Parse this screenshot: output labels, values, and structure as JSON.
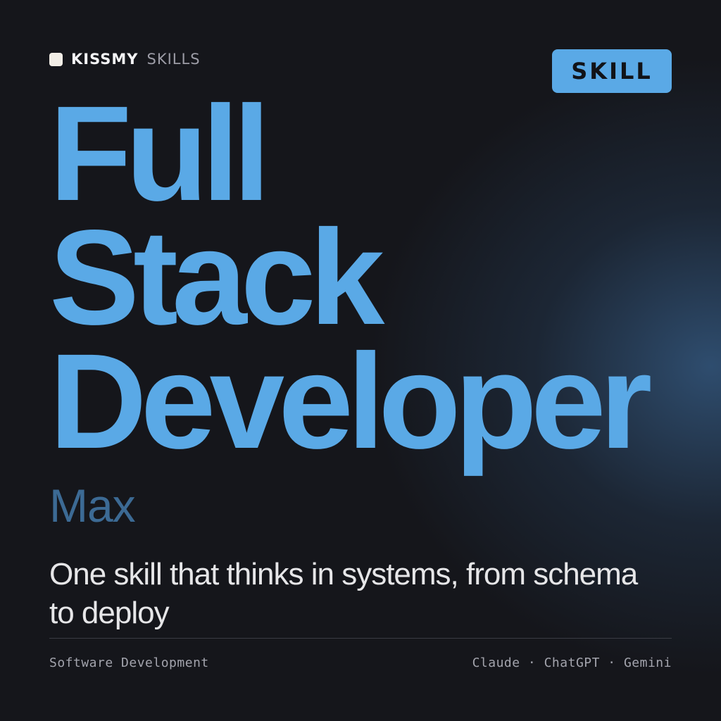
{
  "brand": {
    "strong": "KISSMY",
    "light": "SKILLS"
  },
  "badge": {
    "label": "SKILL"
  },
  "title": {
    "lines": [
      "Full",
      "Stack",
      "Developer"
    ]
  },
  "author": "Max",
  "tagline": "One skill that thinks in systems, from schema to deploy",
  "footer": {
    "category": "Software Development",
    "platforms": "Claude · ChatGPT · Gemini"
  },
  "colors": {
    "accent": "#5aa9e6",
    "author": "#3c6a94",
    "background": "#15161b"
  }
}
